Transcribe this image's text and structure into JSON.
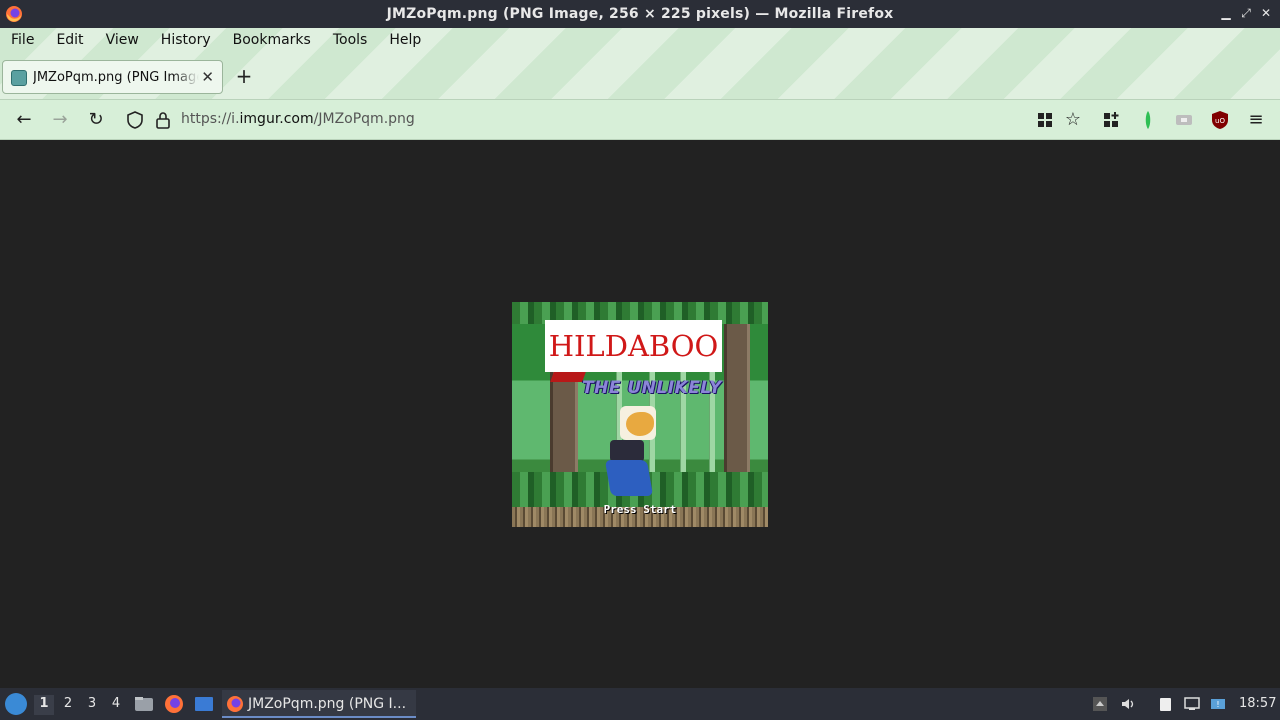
{
  "window": {
    "title": "JMZoPqm.png (PNG Image, 256 × 225 pixels) — Mozilla Firefox",
    "controls": [
      "minimize",
      "maximize",
      "close"
    ]
  },
  "menubar": {
    "items": [
      {
        "label": "File",
        "underline": "F"
      },
      {
        "label": "Edit",
        "underline": "E"
      },
      {
        "label": "View",
        "underline": "V"
      },
      {
        "label": "History",
        "underline": "s"
      },
      {
        "label": "Bookmarks",
        "underline": "B"
      },
      {
        "label": "Tools",
        "underline": "T"
      },
      {
        "label": "Help",
        "underline": "H"
      }
    ]
  },
  "tabs": [
    {
      "title": "JMZoPqm.png (PNG Image, 256 × 225 pixels)",
      "active": true
    }
  ],
  "navbar": {
    "url_prefix": "https://i.",
    "url_host": "imgur.com",
    "url_path": "/JMZoPqm.png",
    "icons": [
      "back-icon",
      "forward-icon",
      "reload-icon",
      "shield-icon",
      "lock-icon",
      "grid-icon",
      "star-icon",
      "extensions-icon",
      "leaf-extension-icon",
      "extension-icon",
      "ublock-icon",
      "menu-icon"
    ],
    "ublock_badge": "uO"
  },
  "image": {
    "logo_text": "HILDABOO",
    "subtitle_text": "THE UNLIKELY",
    "press_start": "Press Start"
  },
  "taskbar": {
    "workspaces": [
      "1",
      "2",
      "3",
      "4"
    ],
    "active_workspace": "1",
    "task_label": "JMZoPqm.png (PNG I...",
    "clock": "18:57"
  },
  "colors": {
    "titlebar": "#2b2e37",
    "chrome": "#cfe8d0",
    "content_bg": "#222222",
    "logo_red": "#d01818"
  }
}
